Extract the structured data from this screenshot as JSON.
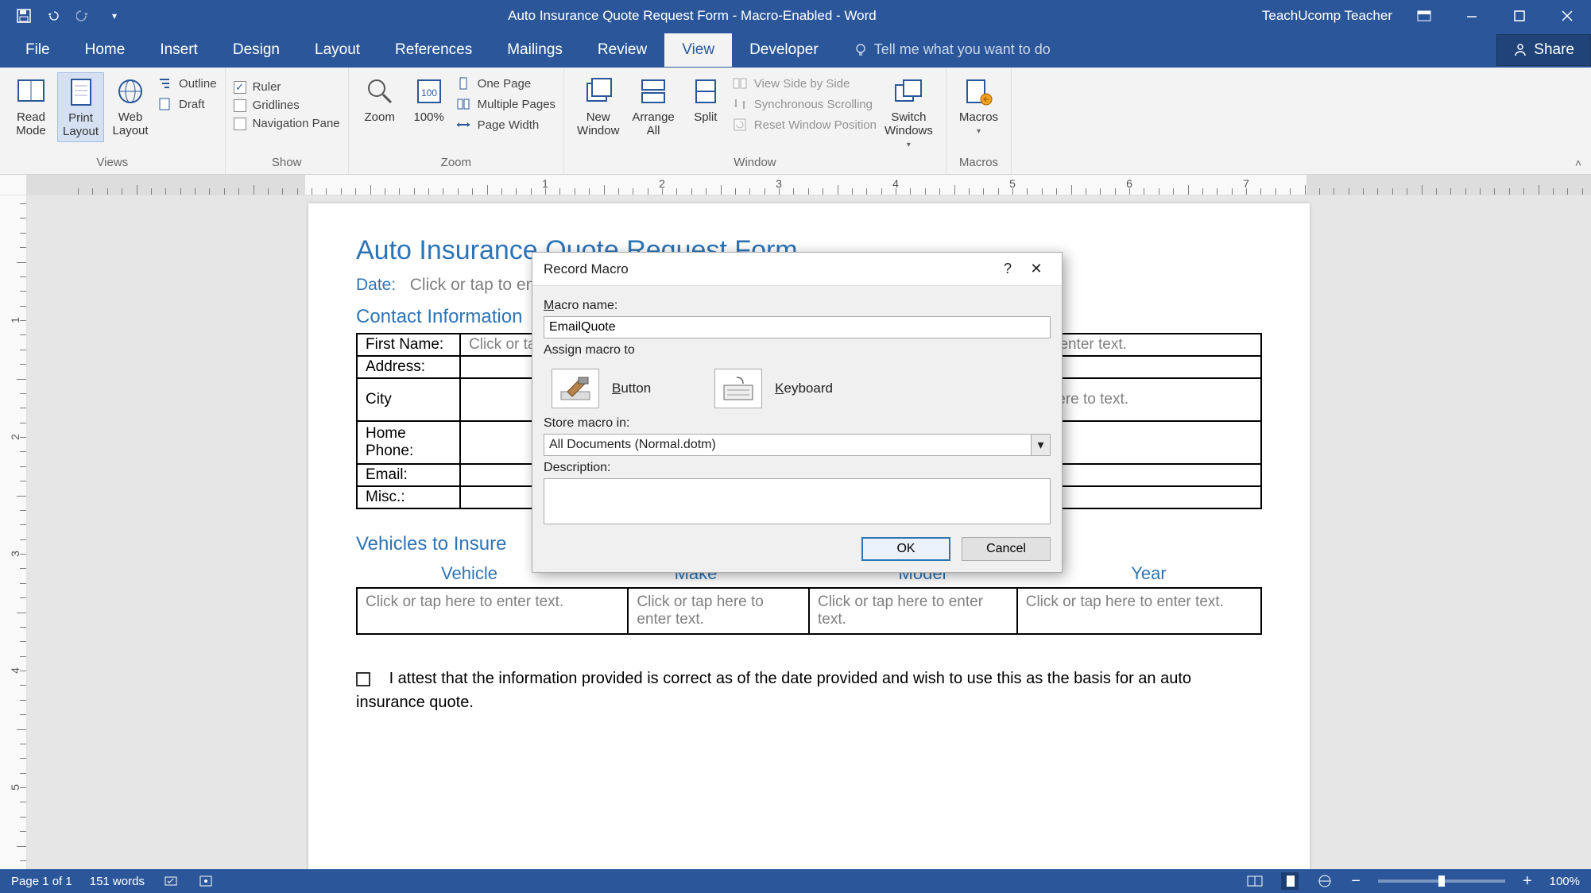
{
  "titlebar": {
    "title": "Auto Insurance Quote Request Form - Macro-Enabled - Word",
    "account": "TeachUcomp Teacher"
  },
  "tabs": {
    "file": "File",
    "home": "Home",
    "insert": "Insert",
    "design": "Design",
    "layout": "Layout",
    "references": "References",
    "mailings": "Mailings",
    "review": "Review",
    "view": "View",
    "developer": "Developer",
    "tell_me": "Tell me what you want to do",
    "share": "Share"
  },
  "ribbon": {
    "views": {
      "read_mode": "Read\nMode",
      "print_layout": "Print\nLayout",
      "web_layout": "Web\nLayout",
      "outline": "Outline",
      "draft": "Draft",
      "group": "Views"
    },
    "show": {
      "ruler": "Ruler",
      "gridlines": "Gridlines",
      "nav": "Navigation Pane",
      "group": "Show"
    },
    "zoom": {
      "zoom": "Zoom",
      "hundred": "100%",
      "one_page": "One Page",
      "multi": "Multiple Pages",
      "page_width": "Page Width",
      "group": "Zoom"
    },
    "window": {
      "new_window": "New\nWindow",
      "arrange_all": "Arrange\nAll",
      "split": "Split",
      "side": "View Side by Side",
      "sync": "Synchronous Scrolling",
      "reset": "Reset Window Position",
      "switch": "Switch\nWindows",
      "group": "Window"
    },
    "macros": {
      "macros": "Macros",
      "group": "Macros"
    }
  },
  "document": {
    "title": "Auto Insurance Quote Request Form",
    "date_label": "Date:",
    "date_placeholder": "Click or tap to enter a date.",
    "contact_heading": "Contact Information",
    "contact_rows": {
      "first_name": "First Name:",
      "address": "Address:",
      "city": "City",
      "home_phone": "Home Phone:",
      "email": "Email:",
      "misc": "Misc.:"
    },
    "placeholder_short": "Click or tap here to enter text.",
    "placeholder_wrap": "tap here to text.",
    "vehicles_heading": "Vehicles to Insure",
    "vehicles_headers": {
      "vehicle": "Vehicle",
      "make": "Make",
      "model": "Model",
      "year": "Year"
    },
    "vehicles_cells": {
      "c1": "Click or tap here to enter text.",
      "c2": "Click or tap here to enter text.",
      "c3": "Click or tap here to enter text.",
      "c4": "Click or tap here to enter text."
    },
    "attest": "I attest that the information provided is correct as of the date provided and wish to use this as the basis for an auto insurance quote."
  },
  "dialog": {
    "title": "Record Macro",
    "macro_name_label": "Macro name:",
    "macro_name_value": "EmailQuote",
    "assign_label": "Assign macro to",
    "button_label": "Button",
    "keyboard_label": "Keyboard",
    "store_label": "Store macro in:",
    "store_value": "All Documents (Normal.dotm)",
    "description_label": "Description:",
    "description_value": "",
    "ok": "OK",
    "cancel": "Cancel"
  },
  "statusbar": {
    "page": "Page 1 of 1",
    "words": "151 words",
    "zoom_pct": "100%"
  },
  "ruler_numbers": [
    "1",
    "2",
    "3",
    "4",
    "5",
    "6",
    "7"
  ],
  "vruler_numbers": [
    "1",
    "2",
    "3",
    "4",
    "5"
  ]
}
